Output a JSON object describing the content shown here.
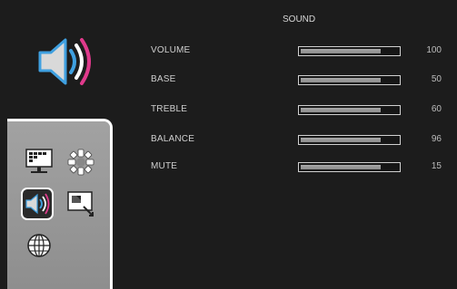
{
  "title": "SOUND",
  "settings": [
    {
      "label": "VOLUME",
      "value": "100",
      "level": 0.82
    },
    {
      "label": "BASE",
      "value": "50",
      "level": 0.82
    },
    {
      "label": "TREBLE",
      "value": "60",
      "level": 0.82
    },
    {
      "label": "BALANCE",
      "value": "96",
      "level": 0.82
    },
    {
      "label": "MUTE",
      "value": "15",
      "level": 0.82
    }
  ],
  "menu": [
    {
      "name": "picture-icon",
      "selected": false
    },
    {
      "name": "settings-gear-icon",
      "selected": false
    },
    {
      "name": "sound-icon",
      "selected": true
    },
    {
      "name": "image-adjust-icon",
      "selected": false
    },
    {
      "name": "language-globe-icon",
      "selected": false
    }
  ],
  "colors": {
    "background": "#1c1c1c",
    "panel": "#9a9a9a",
    "bar_fill": "#9a9a9a",
    "accent_blue": "#3fa0e0",
    "accent_pink": "#e03a8c"
  }
}
